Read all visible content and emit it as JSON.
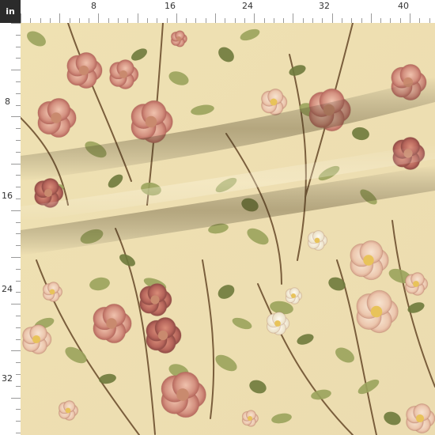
{
  "ruler": {
    "unit_label": "in",
    "top_labels": [
      "8",
      "16",
      "24",
      "32",
      "40"
    ],
    "left_labels": [
      "8",
      "16",
      "24",
      "32"
    ]
  },
  "colors": {
    "background": "#efe2b8",
    "rose_pink": "#d99a8a",
    "rose_deep": "#b8695e",
    "rose_pale": "#f1d3bf",
    "white_rose": "#f5efda",
    "rose_center": "#e8c35a",
    "leaf": "#9aa35c",
    "leaf_dark": "#6e7a3c",
    "stem": "#7a5e3c",
    "fold_shadow": "#7a6a40"
  }
}
